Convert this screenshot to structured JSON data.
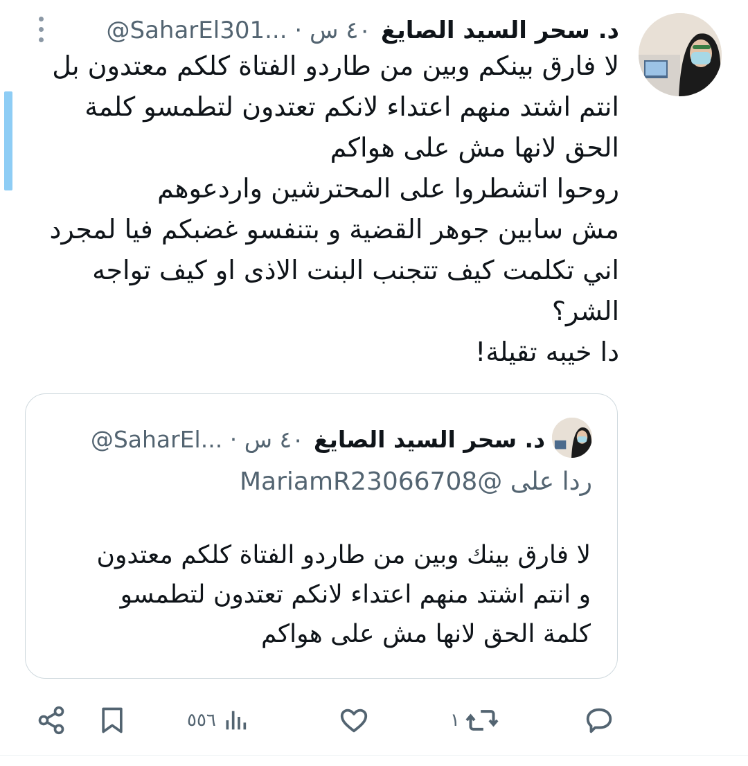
{
  "tweet": {
    "author_name": "د. سحر السيد الصايغ",
    "author_handle": "@SaharEl301...",
    "time": "٤٠ س",
    "separator": "·",
    "text_lines": [
      "لا فارق بينكم وبين من طاردو الفتاة كلكم معتدون بل",
      "انتم اشتد منهم اعتداء لانكم تعتدون لتطمسو كلمة",
      "الحق لانها مش على هواكم",
      "روحوا اتشطروا على المحترشين واردعوهم",
      "مش سابين جوهر القضية و بتنفسو غضبكم فيا لمجرد",
      "اني تكلمت كيف تتجنب البنت الاذى او كيف تواجه",
      "الشر؟",
      "دا خيبه تقيلة!"
    ]
  },
  "quoted": {
    "author_name": "د. سحر السيد الصايغ",
    "author_handle": "@SaharEl...",
    "time": "٤٠ س",
    "separator": "·",
    "reply_prefix": "ردا على",
    "reply_handle": "@MariamR23066708",
    "text_lines": [
      "لا فارق بينك وبين من طاردو الفتاة كلكم معتدون",
      "و انتم اشتد منهم اعتداء لانكم تعتدون لتطمسو",
      "كلمة الحق لانها مش على هواكم"
    ]
  },
  "actions": {
    "reply_count": "",
    "retweet_count": "١",
    "like_count": "",
    "views_count": "٥٥٦",
    "icons": [
      "reply-icon",
      "retweet-icon",
      "like-icon",
      "views-icon",
      "bookmark-icon",
      "share-icon"
    ]
  },
  "colors": {
    "text": "#0f1419",
    "secondary": "#536471",
    "accent_bar": "#8ecdf5",
    "border": "#cfd9de"
  }
}
